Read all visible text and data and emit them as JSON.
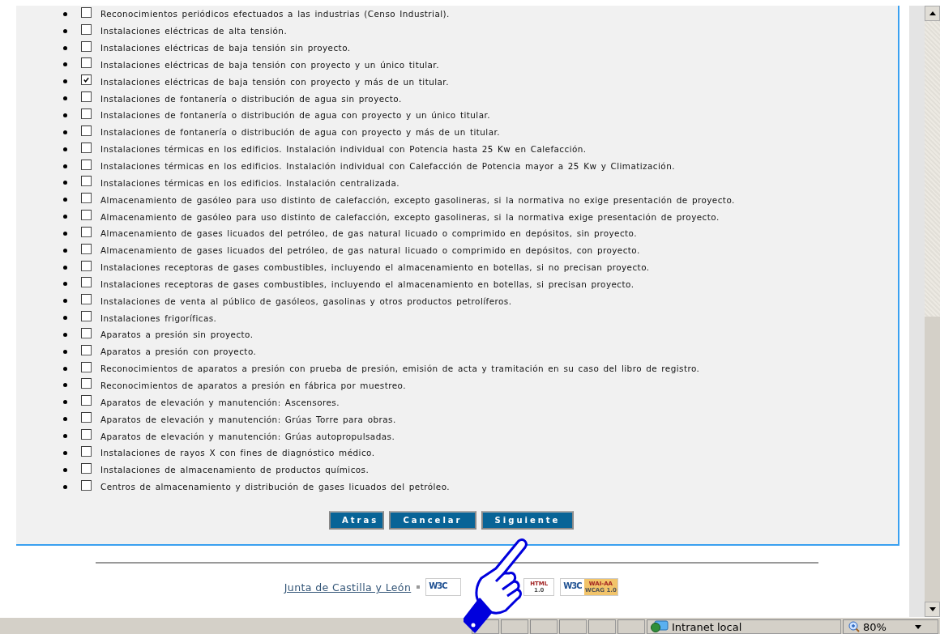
{
  "items": [
    {
      "label": "Reconocimientos periódicos efectuados a las industrias (Censo Industrial).",
      "checked": false
    },
    {
      "label": "Instalaciones eléctricas de alta tensión.",
      "checked": false
    },
    {
      "label": "Instalaciones eléctricas de baja tensión sin proyecto.",
      "checked": false
    },
    {
      "label": "Instalaciones eléctricas de baja tensión con proyecto y un único titular.",
      "checked": false
    },
    {
      "label": "Instalaciones eléctricas de baja tensión con proyecto y más de un titular.",
      "checked": true
    },
    {
      "label": "Instalaciones de fontanería o distribución de agua sin proyecto.",
      "checked": false
    },
    {
      "label": "Instalaciones de fontanería o distribución de agua con proyecto y un único titular.",
      "checked": false
    },
    {
      "label": "Instalaciones de fontanería o distribución de agua con proyecto y más de un titular.",
      "checked": false
    },
    {
      "label": "Instalaciones térmicas en los edificios. Instalación individual con Potencia hasta 25 Kw en Calefacción.",
      "checked": false
    },
    {
      "label": "Instalaciones térmicas en los edificios. Instalación individual con Calefacción de Potencia mayor a 25 Kw y Climatización.",
      "checked": false
    },
    {
      "label": "Instalaciones térmicas en los edificios. Instalación centralizada.",
      "checked": false
    },
    {
      "label": "Almacenamiento de gasóleo para uso distinto de calefacción, excepto gasolineras, si la normativa no exige presentación de proyecto.",
      "checked": false
    },
    {
      "label": "Almacenamiento de gasóleo para uso distinto de calefacción, excepto gasolineras, si la normativa exige presentación de proyecto.",
      "checked": false
    },
    {
      "label": "Almacenamiento de gases licuados del petróleo, de gas natural licuado o comprimido en depósitos, sin proyecto.",
      "checked": false
    },
    {
      "label": "Almacenamiento de gases licuados del petróleo, de gas natural licuado o comprimido en depósitos, con proyecto.",
      "checked": false
    },
    {
      "label": "Instalaciones receptoras de gases combustibles, incluyendo el almacenamiento en botellas, si no precisan proyecto.",
      "checked": false
    },
    {
      "label": "Instalaciones receptoras de gases combustibles, incluyendo el almacenamiento en botellas, si precisan proyecto.",
      "checked": false
    },
    {
      "label": "Instalaciones de venta al público de gasóleos, gasolinas y otros productos petrolíferos.",
      "checked": false
    },
    {
      "label": "Instalaciones frigoríficas.",
      "checked": false
    },
    {
      "label": "Aparatos a presión sin proyecto.",
      "checked": false
    },
    {
      "label": "Aparatos a presión con proyecto.",
      "checked": false
    },
    {
      "label": "Reconocimientos de aparatos a presión con prueba de presión, emisión de acta y tramitación en su caso del libro de registro.",
      "checked": false
    },
    {
      "label": "Reconocimientos de aparatos a presión en fábrica por muestreo.",
      "checked": false
    },
    {
      "label": "Aparatos de elevación y manutención: Ascensores.",
      "checked": false
    },
    {
      "label": "Aparatos de elevación y manutención: Grúas Torre para obras.",
      "checked": false
    },
    {
      "label": "Aparatos de elevación y manutención: Grúas autopropulsadas.",
      "checked": false
    },
    {
      "label": "Instalaciones de rayos X con fines de diagnóstico médico.",
      "checked": false
    },
    {
      "label": "Instalaciones de almacenamiento de productos químicos.",
      "checked": false
    },
    {
      "label": "Centros de almacenamiento y distribución de gases licuados del petróleo.",
      "checked": false
    }
  ],
  "buttons": [
    "Atras",
    "Cancelar",
    "Siguiente"
  ],
  "footer": {
    "link": "Junta de Castilla y León",
    "badges": [
      {
        "logo": "W3C"
      },
      {
        "label": "HTML",
        "sub": "1.0"
      },
      {
        "logo": "W3C",
        "label": "WAI-AA",
        "sub": "WCAG 1.0"
      }
    ]
  },
  "status_bar": {
    "zone": "Intranet local",
    "zoom": "80%"
  }
}
